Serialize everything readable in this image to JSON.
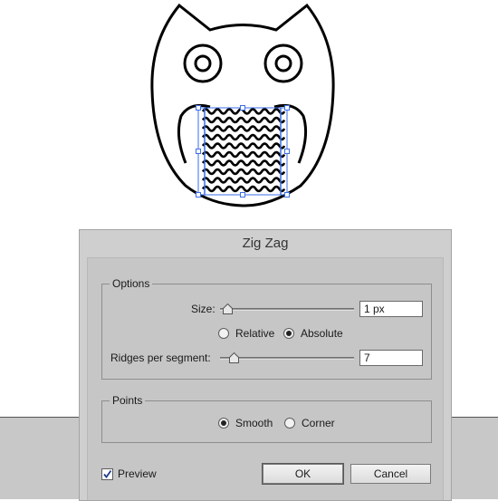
{
  "dialog": {
    "title": "Zig Zag",
    "options": {
      "legend": "Options",
      "size_label": "Size:",
      "size_value": "1 px",
      "size_slider": 0.02,
      "relative_label": "Relative",
      "absolute_label": "Absolute",
      "size_mode": "Absolute",
      "ridges_label": "Ridges per segment:",
      "ridges_value": "7",
      "ridges_slider": 0.07
    },
    "points": {
      "legend": "Points",
      "smooth_label": "Smooth",
      "corner_label": "Corner",
      "selected": "Smooth"
    },
    "preview_label": "Preview",
    "preview_checked": true,
    "ok_label": "OK",
    "cancel_label": "Cancel"
  },
  "colors": {
    "selection": "#3a6ee8",
    "stroke": "#000000",
    "dialog_bg": "#cfcfcf",
    "pasteboard": "#c8c8c8"
  }
}
